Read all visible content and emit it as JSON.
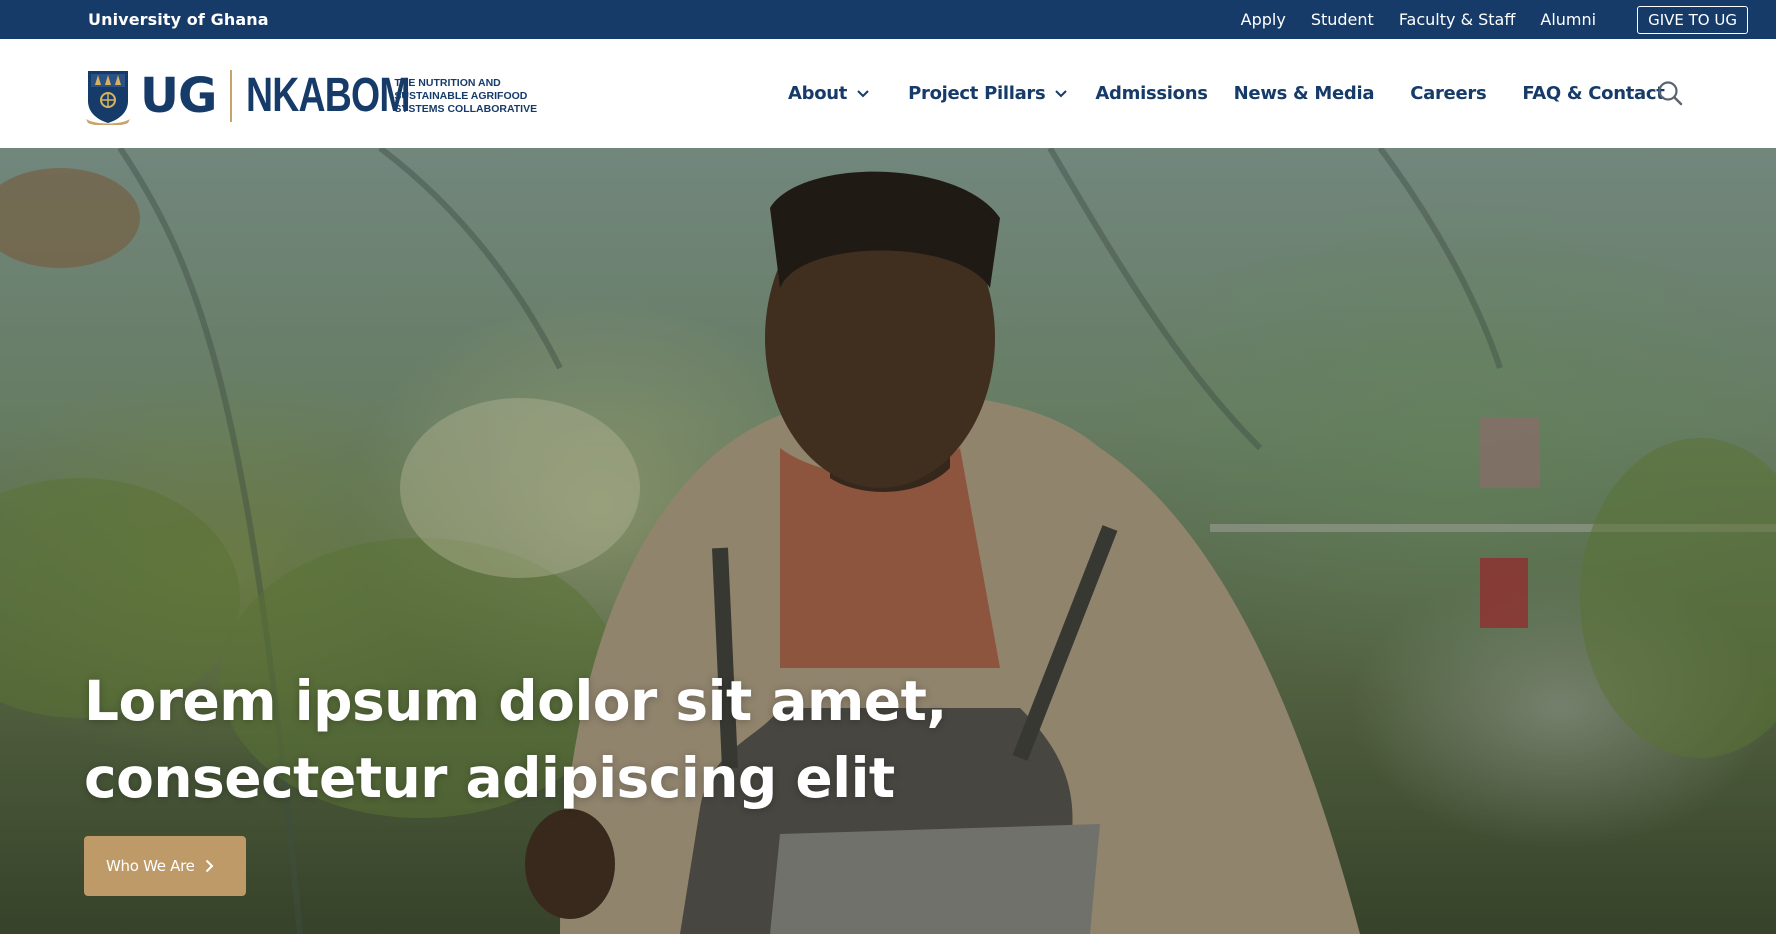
{
  "utility_bar": {
    "university_name": "University of Ghana",
    "links": [
      "Apply",
      "Student",
      "Faculty & Staff",
      "Alumni"
    ],
    "give_button": "GIVE TO UG"
  },
  "header": {
    "logo": {
      "ug": "UG",
      "nkabom": "NKABOM",
      "tagline": "THE NUTRITION AND SUSTAINABLE AGRIFOOD SYSTEMS COLLABORATIVE"
    },
    "nav": [
      {
        "label": "About",
        "has_dropdown": true
      },
      {
        "label": "Project Pillars",
        "has_dropdown": true
      },
      {
        "label": "Admissions",
        "has_dropdown": false
      },
      {
        "label": "News & Media",
        "has_dropdown": false
      },
      {
        "label": "Careers",
        "has_dropdown": false
      },
      {
        "label": "FAQ & Contact",
        "has_dropdown": false
      }
    ],
    "search_icon": "search-icon"
  },
  "hero": {
    "title_line_1": "Lorem ipsum dolor sit amet,",
    "title_line_2": "consectetur adipiscing elit",
    "button_label": "Who We Are",
    "button_icon": "chevron-right-icon"
  },
  "colors": {
    "brand_navy": "#173b69",
    "accent_gold": "#bd9a67",
    "white": "#ffffff"
  }
}
